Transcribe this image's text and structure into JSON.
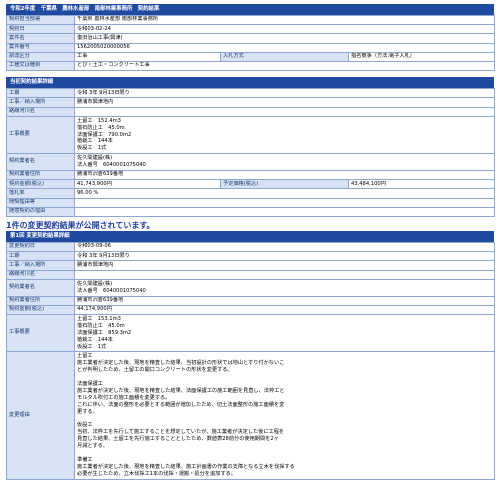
{
  "header": {
    "title": "令和2年度　千葉県　農林水産部　南部林業事務所　契約結果"
  },
  "top": {
    "rows": [
      {
        "label": "契約担当部署",
        "value": "千葉県 農林水産部 南部林業事務所"
      },
      {
        "label": "契約日",
        "value": "令和03-02-24"
      },
      {
        "label": "案件名",
        "value": "復旧治山工事(興津)"
      },
      {
        "label": "案件番号",
        "value": "1562005020000056"
      }
    ],
    "kind": {
      "label": "調達区分",
      "value": "工事",
      "label2": "入札方式",
      "value2": "指名競争（方法:電子入札）"
    },
    "type": {
      "label": "工種又は種目",
      "value": "とび・土工・コンクリート工事"
    }
  },
  "current": {
    "title": "当初契約結果詳細",
    "deadline": {
      "label": "工期",
      "value": "令和 3年 9月13日限り"
    },
    "place": {
      "label": "工事／納入場所",
      "value": "勝浦市興津地内"
    },
    "route": {
      "label": "路線河川名",
      "value": ""
    },
    "summary": {
      "label": "工事概要",
      "lines": [
        "土留工　152.4m3",
        "落石防止工　45.0m",
        "法面保護工　790.0m2",
        "植栽工　144本",
        "仮設工　1式"
      ]
    },
    "contractor": {
      "label": "契約業者名",
      "lines": [
        "佐久間建設(株)",
        "法人番号　6040001075040"
      ]
    },
    "address": {
      "label": "契約業者住所",
      "value": "勝浦市沢倉639番地"
    },
    "amount": {
      "label": "契約金額(税込)",
      "value": "41,743,900円",
      "label2": "予定価格(税込)",
      "value2": "43,484,100円"
    },
    "ratio": {
      "label": "落札率",
      "value": "96.00 %"
    },
    "extra1": {
      "label": "随契理由等",
      "value": ""
    },
    "extra2": {
      "label": "随意契約の理由",
      "value": ""
    }
  },
  "notice": "1件の変更契約結果が公開されています。",
  "change": {
    "title": "第1回 変更契約結果詳細",
    "date": {
      "label": "変更契約日",
      "value": "令和03-09-06"
    },
    "deadline": {
      "label": "工期",
      "value": "令和 3年 9月13日限り"
    },
    "place": {
      "label": "工事／納入場所",
      "value": "勝浦市興津地内"
    },
    "route": {
      "label": "路線河川名",
      "value": ""
    },
    "contractor": {
      "label": "契約業者名",
      "lines": [
        "佐久間建設(株)",
        "法人番号　6040001075040"
      ]
    },
    "address": {
      "label": "契約業者住所",
      "value": "勝浦市沢倉639番地"
    },
    "amount": {
      "label": "契約金額(税込)",
      "value": "44,174,900円"
    },
    "summary": {
      "label": "工事概要",
      "lines": [
        "土留工　153.1m3",
        "落石防止工　45.0m",
        "法面保護工　859.3m2",
        "植栽工　144本",
        "仮設工　1式"
      ]
    },
    "reason": {
      "label": "変更理由",
      "lines": [
        "土留工",
        "施工業者が決定した後、現地を精査した結果、当初設計の形状では地山とすり付かないこ",
        "とが判明したため、土留工の開口コンクリートの形状を変更する。",
        "",
        "法面保護工",
        "施工業者が決定した後、現地を精査した結果、法面保護工の施工範囲を見直し、法枠工と",
        "モルタル吹付工の施工面積を変更する。",
        "これに伴い、法面の整形を必要とする範囲が増加したため、切土法面整形の施工面積を変",
        "更する。",
        "",
        "仮設工",
        "当初、法枠工を先行して施工することを想定していたが、施工業者が決定した後に工程を",
        "見直した結果、土留工を先行施工することとしたため、数値表28前分の使用期間を2ヶ",
        "月減とする。",
        "",
        "準備工",
        "施工業者が決定した後、現地を精査した結果、施工計画書の作業の支障となる立木を伐採する",
        "必要が生じたため、立木伐採工1本の伐採・運搬・処分を追加する。"
      ]
    }
  }
}
